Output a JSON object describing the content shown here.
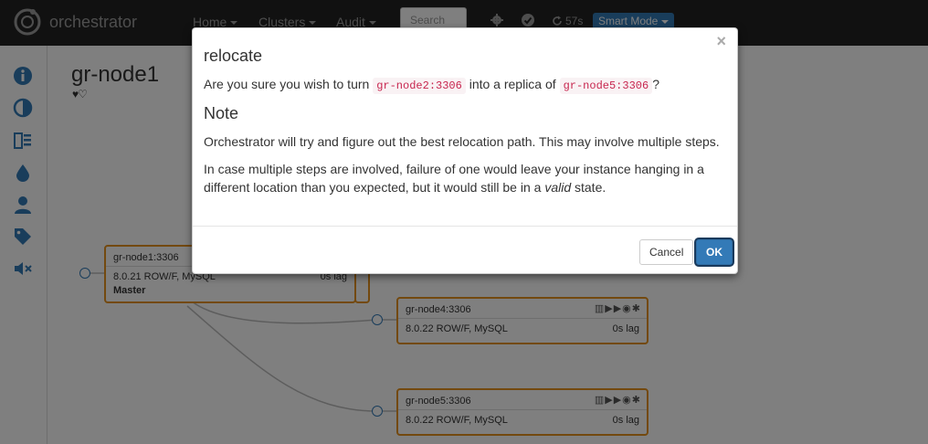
{
  "navbar": {
    "brand": "orchestrator",
    "home": "Home",
    "clusters": "Clusters",
    "audit": "Audit",
    "search_placeholder": "Search",
    "timer": "57s",
    "smart_mode": "Smart Mode"
  },
  "sidebar": {
    "icons": [
      "info-icon",
      "contrast-icon",
      "list-icon",
      "drop-icon",
      "user-icon",
      "tags-icon",
      "mute-icon"
    ]
  },
  "page": {
    "title": "gr-node1",
    "hearts": "♥♡"
  },
  "nodes": [
    {
      "name": "gr-node1:3306",
      "version": "8.0.21 ROW/F, MySQL",
      "lag": "0s lag",
      "role": "Master"
    },
    {
      "name": "gr-node4:3306",
      "version": "8.0.22 ROW/F, MySQL",
      "lag": "0s lag"
    },
    {
      "name": "gr-node5:3306",
      "version": "8.0.22 ROW/F, MySQL",
      "lag": "0s lag"
    }
  ],
  "modal": {
    "title": "relocate",
    "question_prefix": "Are you sure you wish to turn",
    "source": "gr-node2:3306",
    "question_middle": "into a replica of",
    "target": "gr-node5:3306",
    "question_suffix": "?",
    "note_heading": "Note",
    "note_1": "Orchestrator will try and figure out the best relocation path. This may involve multiple steps.",
    "note_2_prefix": "In case multiple steps are involved, failure of one would leave your instance hanging in a different location than you expected, but it would still be in a",
    "note_2_emphasis": "valid",
    "note_2_suffix": "state.",
    "close": "×",
    "cancel": "Cancel",
    "ok": "OK"
  },
  "colors": {
    "navbar": "#222222",
    "accent": "#337ab7",
    "node_border": "#e6921e",
    "code_text": "#c7254e"
  }
}
